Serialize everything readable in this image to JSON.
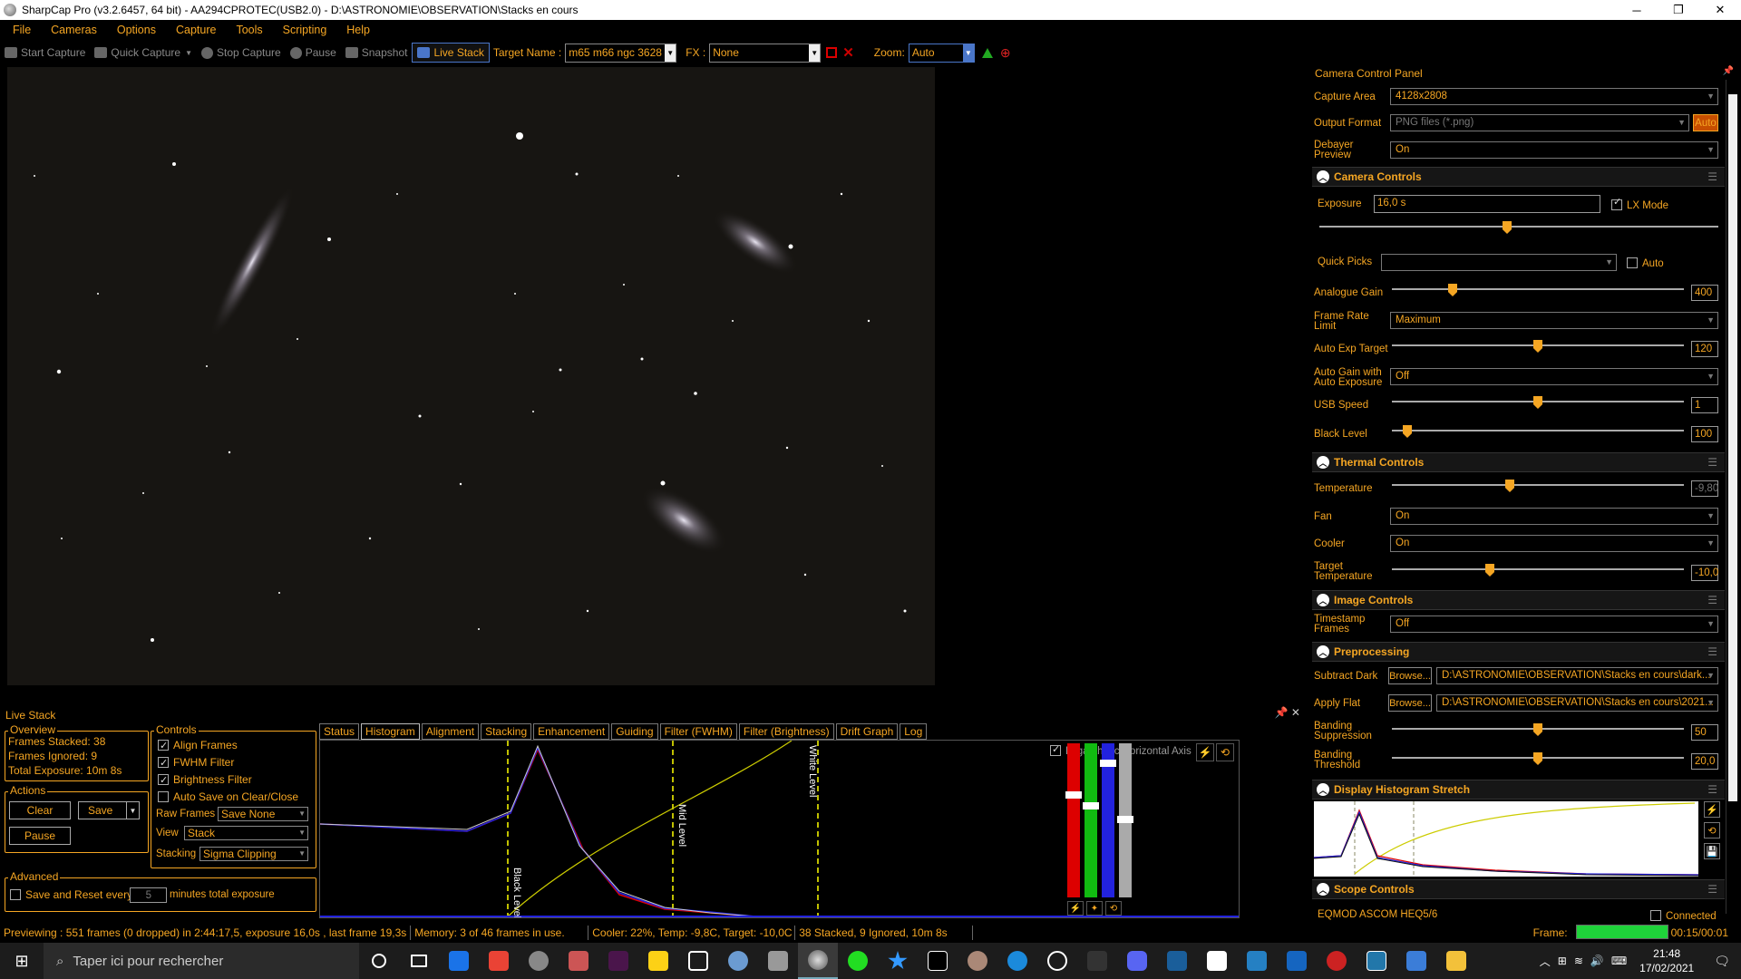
{
  "titlebar": {
    "title": "SharpCap Pro (v3.2.6457, 64 bit) - AA294CPROTEC(USB2.0) - D:\\ASTRONOMIE\\OBSERVATION\\Stacks en cours",
    "minimize": "─",
    "maximize": "❐",
    "close": "✕"
  },
  "menu": [
    "File",
    "Cameras",
    "Options",
    "Capture",
    "Tools",
    "Scripting",
    "Help"
  ],
  "toolbar": {
    "start_capture": "Start Capture",
    "quick_capture": "Quick Capture",
    "stop_capture": "Stop Capture",
    "pause": "Pause",
    "snapshot": "Snapshot",
    "live_stack": "Live Stack",
    "target_label": "Target Name :",
    "target_value": "m65 m66 ngc 3628",
    "fx_label": "FX :",
    "fx_value": "None",
    "zoom_label": "Zoom:",
    "zoom_value": "Auto"
  },
  "livestack": {
    "title": "Live Stack",
    "overview": {
      "title": "Overview",
      "stacked": "Frames Stacked: 38",
      "ignored": "Frames Ignored:  9",
      "exposure": "Total Exposure:   10m 8s"
    },
    "actions": {
      "title": "Actions",
      "clear": "Clear",
      "save": "Save",
      "pause": "Pause"
    },
    "controls": {
      "title": "Controls",
      "align": "Align Frames",
      "fwhm": "FWHM Filter",
      "brightness": "Brightness Filter",
      "autosave": "Auto Save on Clear/Close",
      "raw_label": "Raw Frames",
      "raw_value": "Save None",
      "view_label": "View",
      "view_value": "Stack",
      "stacking_label": "Stacking",
      "stacking_value": "Sigma Clipping"
    },
    "advanced": {
      "title": "Advanced",
      "save_reset": "Save and Reset every",
      "minutes_value": "5",
      "minutes_label": "minutes total exposure"
    },
    "tabs": [
      "Status",
      "Histogram",
      "Alignment",
      "Stacking",
      "Enhancement",
      "Guiding",
      "Filter (FWHM)",
      "Filter (Brightness)",
      "Drift Graph",
      "Log"
    ],
    "active_tab": "Histogram",
    "histogram": {
      "log_axis": "Logarithmic Horizontal Axis",
      "black": "Black Level",
      "mid": "Mid Level",
      "white": "White Level"
    }
  },
  "statusbar": {
    "preview": "Previewing : 551 frames (0 dropped) in 2:44:17,5, exposure 16,0s , last frame 19,3s",
    "memory": "Memory: 3 of 46 frames in use.",
    "cooler": "Cooler: 22%, Temp: -9,8C, Target: -10,0C",
    "stack": "38 Stacked, 9 Ignored, 10m 8s",
    "frame_label": "Frame:",
    "frame_time": "00:15/00:01"
  },
  "ccp": {
    "title": "Camera Control Panel",
    "capture_area_label": "Capture Area",
    "capture_area": "4128x2808",
    "output_format_label": "Output Format",
    "output_format": "PNG files (*.png)",
    "auto_btn": "Auto",
    "debayer_label": "Debayer Preview",
    "debayer": "On",
    "camera_controls": "Camera Controls",
    "exposure_label": "Exposure",
    "exposure": "16,0 s",
    "lx_mode": "LX Mode",
    "quick_picks_label": "Quick Picks",
    "auto_label": "Auto",
    "gain_label": "Analogue Gain",
    "gain": "400",
    "frame_rate_label": "Frame Rate Limit",
    "frame_rate": "Maximum",
    "auto_exp_label": "Auto Exp Target",
    "auto_exp": "120",
    "auto_gain_label": "Auto Gain with Auto Exposure",
    "auto_gain": "Off",
    "usb_label": "USB Speed",
    "usb": "1",
    "black_label": "Black Level",
    "black": "100",
    "thermal_controls": "Thermal Controls",
    "temp_label": "Temperature",
    "temp": "-9,80",
    "fan_label": "Fan",
    "fan": "On",
    "cooler_label": "Cooler",
    "cooler": "On",
    "target_temp_label": "Target Temperature",
    "target_temp": "-10,0",
    "image_controls": "Image Controls",
    "timestamp_label": "Timestamp Frames",
    "timestamp": "Off",
    "preprocessing": "Preprocessing",
    "dark_label": "Subtract Dark",
    "browse": "Browse...",
    "dark_path": "D:\\ASTRONOMIE\\OBSERVATION\\Stacks en cours\\dark...",
    "flat_label": "Apply Flat",
    "flat_path": "D:\\ASTRONOMIE\\OBSERVATION\\Stacks en cours\\2021...",
    "banding_sup_label": "Banding Suppression",
    "banding_sup": "50",
    "banding_thr_label": "Banding Threshold",
    "banding_thr": "20,0",
    "display_histo": "Display Histogram Stretch",
    "scope_controls": "Scope Controls",
    "scope": "EQMOD ASCOM HEQ5/6",
    "connected": "Connected"
  },
  "taskbar": {
    "search": "Taper ici pour rechercher",
    "time": "21:48",
    "date": "17/02/2021"
  },
  "colors": {
    "accent": "#f5a623",
    "background": "#000000",
    "highlight": "#4a76c9"
  }
}
